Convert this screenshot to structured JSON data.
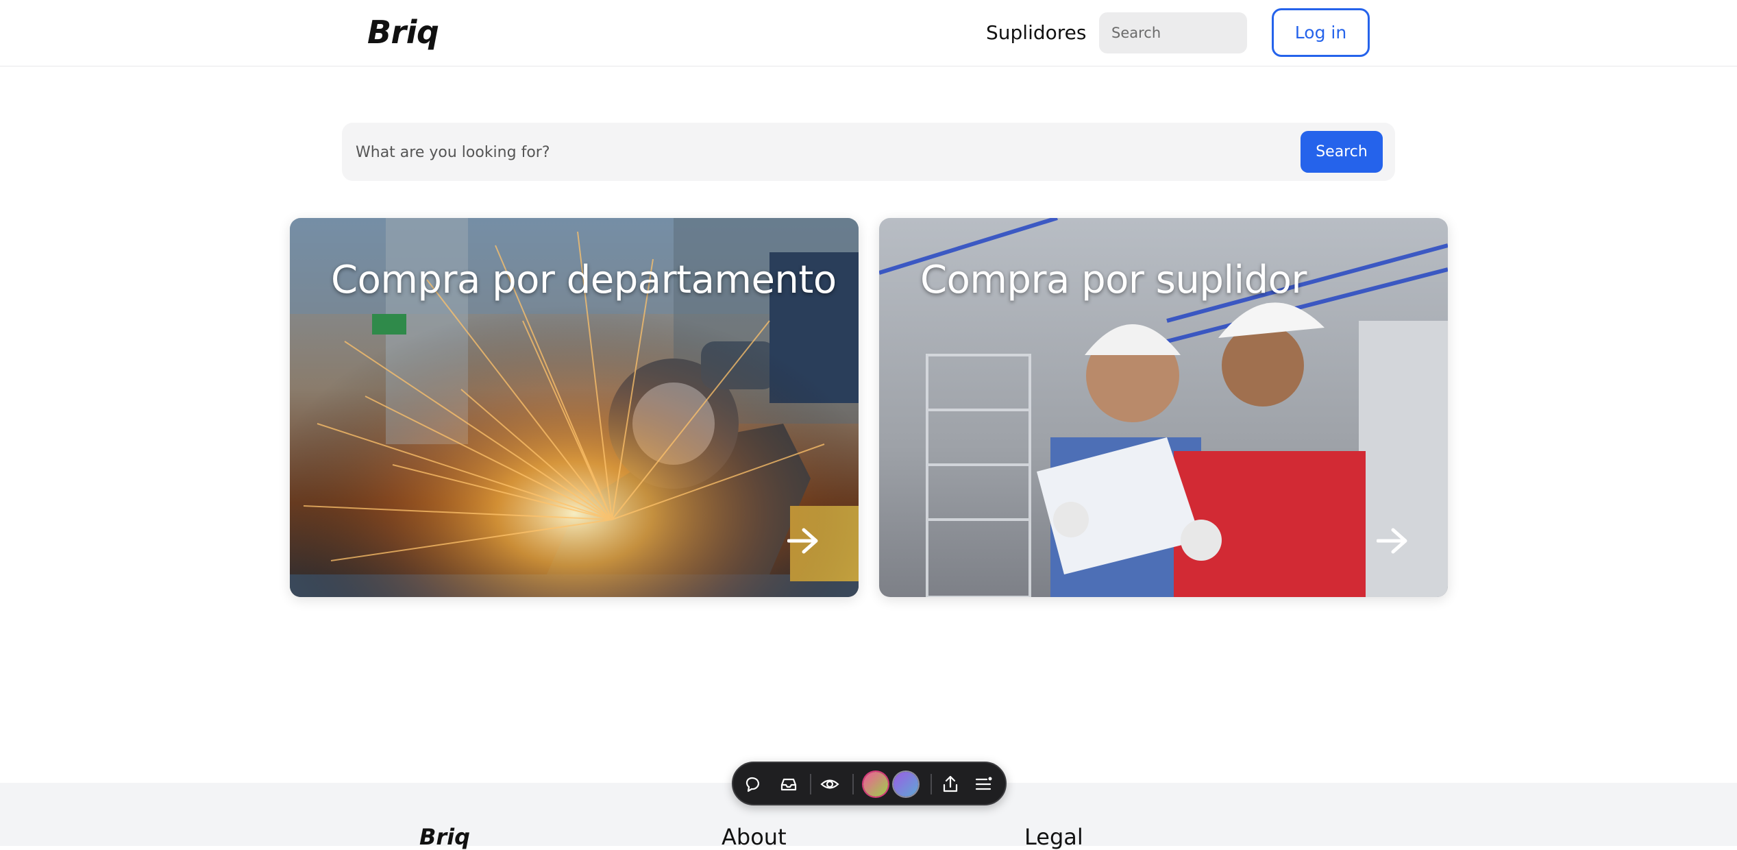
{
  "header": {
    "logo": "Briq",
    "nav_link": "Suplidores",
    "search_placeholder": "Search",
    "login_label": "Log in"
  },
  "main_search": {
    "placeholder": "What are you looking for?",
    "button_label": "Search"
  },
  "cards": [
    {
      "title": "Compra por departamento",
      "icon": "arrow-right-icon"
    },
    {
      "title": "Compra por suplidor",
      "icon": "arrow-right-icon"
    }
  ],
  "footer": {
    "brand": "Briq",
    "about": "About",
    "legal": "Legal"
  },
  "toolbar": {
    "icons": [
      "comment-icon",
      "inbox-icon",
      "eye-icon",
      "share-icon",
      "menu-icon"
    ]
  },
  "colors": {
    "accent": "#2563eb",
    "toolbar_bg": "#1f1f21",
    "footer_bg": "#f3f4f6"
  }
}
